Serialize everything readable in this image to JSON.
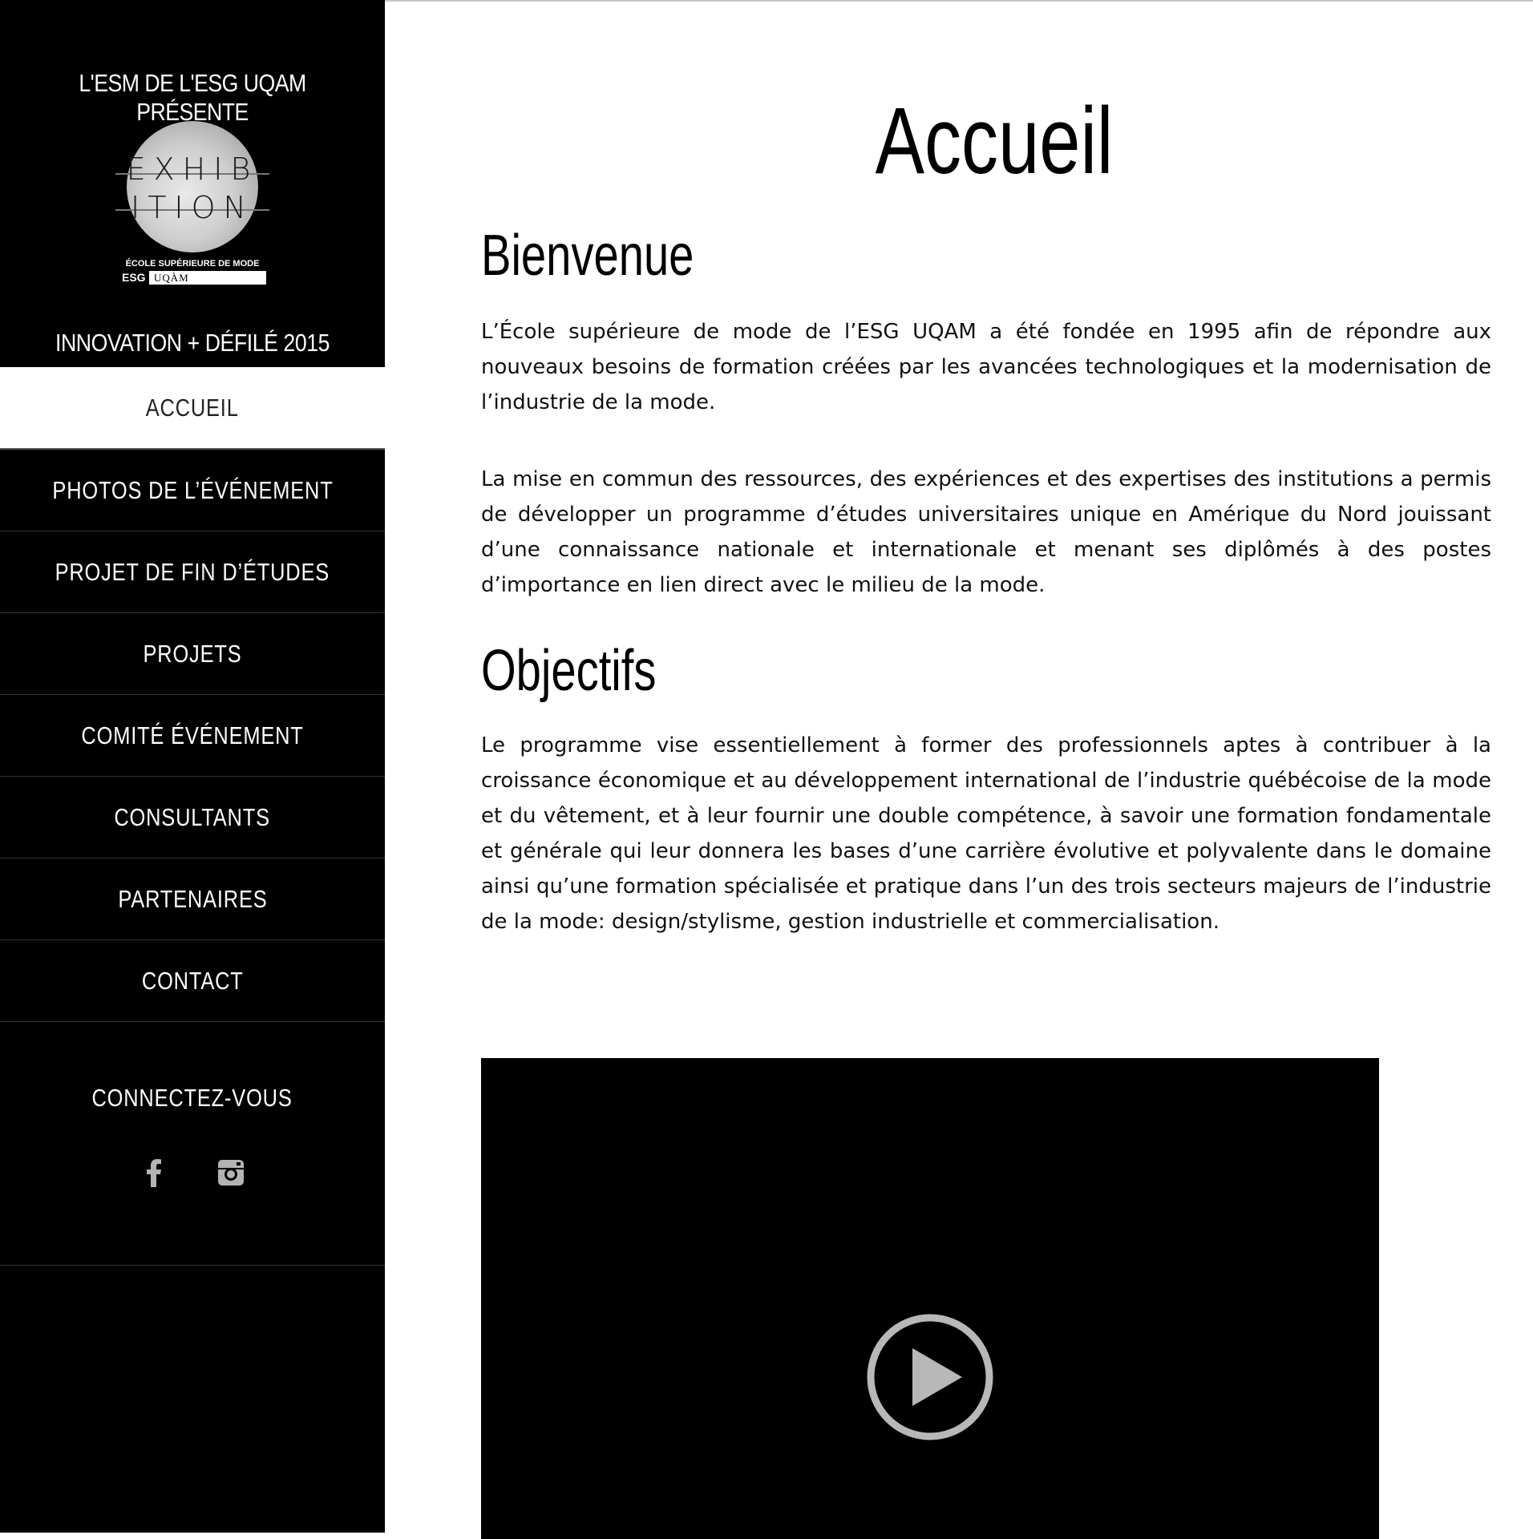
{
  "sidebar": {
    "presents": "L'ESM DE L'ESG UQAM PRÉSENTE",
    "logo": {
      "word_line1": "EXHIB",
      "word_line2": "ITION",
      "school": "ÉCOLE SUPÉRIEURE DE MODE",
      "esg": "ESG",
      "uqam": "UQÀM"
    },
    "event_title": "INNOVATION + DÉFILÉ 2015",
    "nav": [
      {
        "label": "ACCUEIL",
        "active": true
      },
      {
        "label": "PHOTOS DE L’ÉVÉNEMENT"
      },
      {
        "label": "PROJET DE FIN D’ÉTUDES"
      },
      {
        "label": "PROJETS"
      },
      {
        "label": "COMITÉ ÉVÉNEMENT"
      },
      {
        "label": "CONSULTANTS"
      },
      {
        "label": "PARTENAIRES"
      },
      {
        "label": "CONTACT"
      }
    ],
    "connect_label": "CONNECTEZ-VOUS",
    "social": [
      "facebook-icon",
      "instagram-icon"
    ]
  },
  "main": {
    "title": "Accueil",
    "section1": {
      "heading": "Bienvenue",
      "p1": "L’École supérieure de mode de l’ESG UQAM a été fondée en 1995 afin de répondre aux nouveaux besoins de formation créées par les avancées technologiques et la modernisation de l’industrie de la mode.",
      "p2": "La mise en commun des ressources, des expériences et des expertises des institutions a permis de développer un programme d’études universitaires unique en Amérique du Nord jouissant d’une connaissance nationale et internationale et menant ses diplômés à des postes d’importance en lien direct avec le milieu de la mode."
    },
    "section2": {
      "heading": "Objectifs",
      "p1": "Le programme vise essentiellement à former des professionnels aptes à contribuer à la croissance économique et au développement international de l’industrie québécoise de la mode et du vêtement, et à leur fournir une double compétence, à savoir une formation fondamentale et générale qui leur donnera les bases d’une carrière évolutive et polyvalente dans le domaine ainsi qu’une formation spécialisée et pratique dans l’un des trois secteurs majeurs de l’industrie de la mode: design/stylisme, gestion industrielle et commercialisation."
    },
    "video": {
      "icon": "play-icon"
    }
  },
  "colors": {
    "sidebar_bg": "#000000",
    "page_bg": "#ffffff",
    "icon_gray": "#b3b3b3"
  }
}
